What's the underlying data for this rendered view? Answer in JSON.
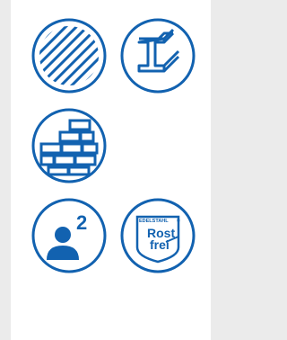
{
  "icons": [
    {
      "id": "wood",
      "icon": "wood-grain-icon"
    },
    {
      "id": "steel",
      "icon": "steel-beam-icon"
    },
    {
      "id": "brick",
      "icon": "brick-wall-icon"
    },
    {
      "id": "persons",
      "icon": "two-persons-icon",
      "count": "2"
    },
    {
      "id": "stainless",
      "icon": "stainless-steel-badge-icon",
      "top_label": "EDELSTAHL",
      "line1": "Rost",
      "line2": "frei",
      "registered": "®"
    }
  ],
  "colors": {
    "accent": "#1262b0",
    "background": "#ebebeb",
    "panel": "#ffffff"
  }
}
